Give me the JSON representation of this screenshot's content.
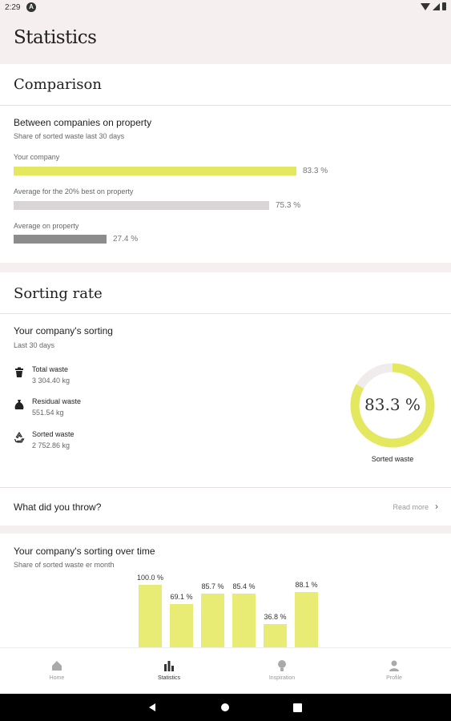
{
  "status_bar": {
    "time": "2:29",
    "notification_icon": "A"
  },
  "app_bar": {
    "title": "Statistics"
  },
  "comparison": {
    "section_title": "Comparison",
    "heading": "Between companies on property",
    "subheading": "Share of sorted waste last 30 days",
    "bars": [
      {
        "label": "Your company",
        "value_text": "83.3 %",
        "value": 83.3,
        "color": "#e4e85e"
      },
      {
        "label": "Average for the 20% best on property",
        "value_text": "75.3 %",
        "value": 75.3,
        "color": "#d9d5d5"
      },
      {
        "label": "Average on property",
        "value_text": "27.4 %",
        "value": 27.4,
        "color": "#8c8c8c"
      }
    ]
  },
  "sorting_rate": {
    "section_title": "Sorting rate",
    "heading": "Your company's sorting",
    "subheading": "Last 30 days",
    "stats": [
      {
        "name": "Total waste",
        "value": "3 304.40 kg",
        "icon": "trash-icon"
      },
      {
        "name": "Residual waste",
        "value": "551.54 kg",
        "icon": "bag-icon"
      },
      {
        "name": "Sorted waste",
        "value": "2 752.86 kg",
        "icon": "recycle-icon"
      }
    ],
    "donut": {
      "value_text": "83.3 %",
      "fraction": 0.833,
      "label": "Sorted waste",
      "color": "#e4e85e",
      "track_color": "#f1ecec"
    }
  },
  "throw_link": {
    "question": "What did you throw?",
    "link_text": "Read more"
  },
  "over_time": {
    "heading": "Your company's sorting over time",
    "subheading": "Share of sorted waste er month",
    "chart_data": {
      "type": "bar",
      "values": [
        100.0,
        69.1,
        85.7,
        85.4,
        36.8,
        88.1
      ],
      "labels": [
        "100.0 %",
        "69.1 %",
        "85.7 %",
        "85.4 %",
        "36.8 %",
        "88.1 %"
      ],
      "color": "#e8ec74"
    }
  },
  "bottom_nav": {
    "items": [
      {
        "label": "Home",
        "icon": "home-icon",
        "active": false
      },
      {
        "label": "Statistics",
        "icon": "bar-chart-icon",
        "active": true
      },
      {
        "label": "Inspiration",
        "icon": "lightbulb-icon",
        "active": false
      },
      {
        "label": "Profile",
        "icon": "person-icon",
        "active": false
      }
    ]
  }
}
